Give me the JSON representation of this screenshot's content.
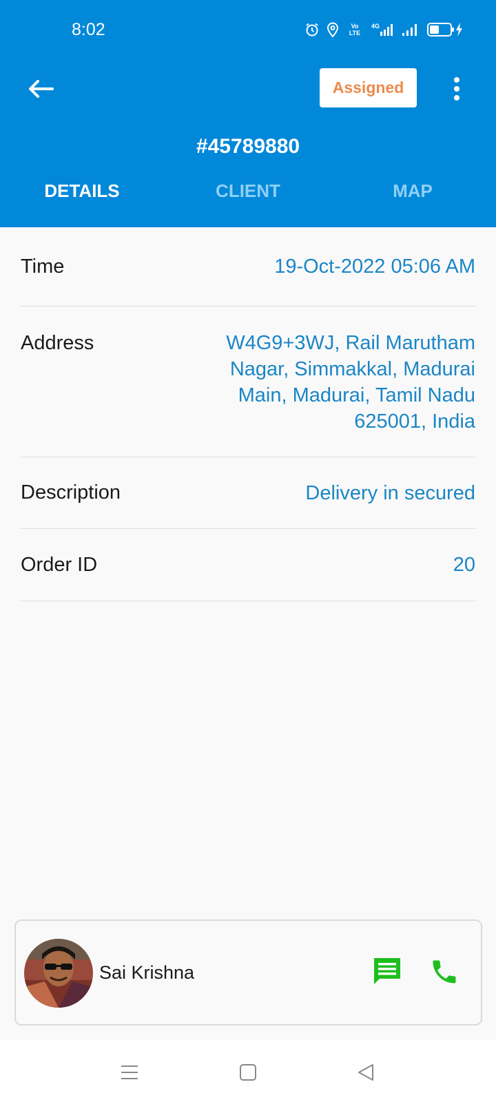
{
  "status_bar": {
    "time": "8:02",
    "icons": [
      "alarm-icon",
      "location-icon",
      "volte-icon",
      "4g-signal-icon",
      "signal-icon",
      "battery-charging-icon"
    ],
    "volte_text": "Vo LTE",
    "network_text": "4G"
  },
  "header": {
    "status_label": "Assigned",
    "order_number": "#45789880",
    "accent_color": "#0288d9",
    "status_color": "#ec8b4c"
  },
  "tabs": [
    {
      "label": "DETAILS",
      "active": true
    },
    {
      "label": "CLIENT",
      "active": false
    },
    {
      "label": "MAP",
      "active": false
    }
  ],
  "details": [
    {
      "label": "Time",
      "value": "19-Oct-2022 05:06 AM"
    },
    {
      "label": "Address",
      "value": "W4G9+3WJ, Rail Marutham Nagar, Simmakkal, Madurai Main, Madurai, Tamil Nadu 625001, India"
    },
    {
      "label": "Description",
      "value": "Delivery in secured"
    },
    {
      "label": "Order ID",
      "value": "20"
    }
  ],
  "contact": {
    "name": "Sai Krishna",
    "actions": [
      "chat-icon",
      "phone-icon"
    ],
    "action_color": "#1fbe1f"
  },
  "nav_bar": {
    "buttons": [
      "menu-icon",
      "home-icon",
      "back-triangle-icon"
    ]
  }
}
